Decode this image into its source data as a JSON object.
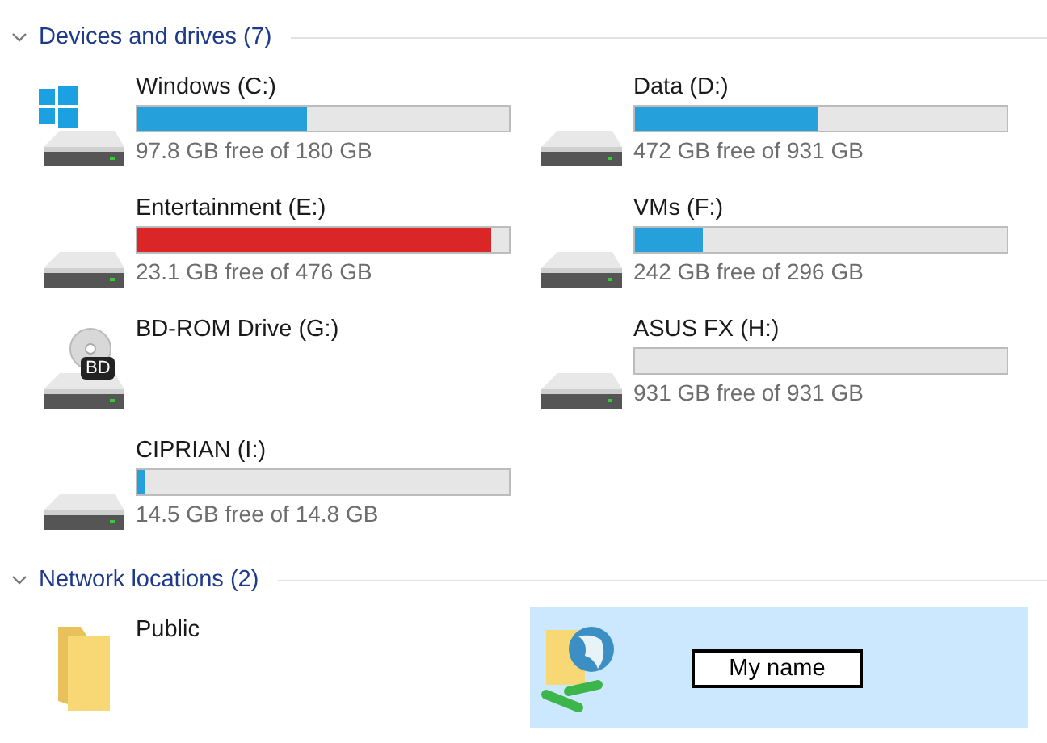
{
  "groups": [
    {
      "title": "Devices and drives (7)",
      "expanded": true,
      "items": [
        {
          "kind": "windows",
          "name": "Windows (C:)",
          "level": 0.457,
          "free": "97.8 GB free of 180 GB"
        },
        {
          "kind": "hdd",
          "name": "Data (D:)",
          "level": 0.493,
          "free": "472 GB free of 931 GB"
        },
        {
          "kind": "hdd",
          "name": "Entertainment (E:)",
          "level": 0.951,
          "free": "23.1 GB free of 476 GB"
        },
        {
          "kind": "hdd",
          "name": "VMs (F:)",
          "level": 0.182,
          "free": "242 GB free of 296 GB"
        },
        {
          "kind": "optical",
          "name": "BD-ROM Drive (G:)",
          "badge": "BD"
        },
        {
          "kind": "hdd",
          "name": "ASUS FX (H:)",
          "free": "931 GB free of 931 GB"
        },
        {
          "kind": "hdd",
          "name": "CIPRIAN (I:)",
          "level": 0.02,
          "free": "14.5 GB free of 14.8 GB"
        }
      ]
    },
    {
      "title": "Network locations (2)",
      "expanded": true,
      "items": [
        {
          "kind": "folder",
          "name": "Public",
          "selected": false,
          "renaming": false
        },
        {
          "kind": "network",
          "name": "My name",
          "selected": true,
          "renaming": true
        }
      ]
    }
  ]
}
